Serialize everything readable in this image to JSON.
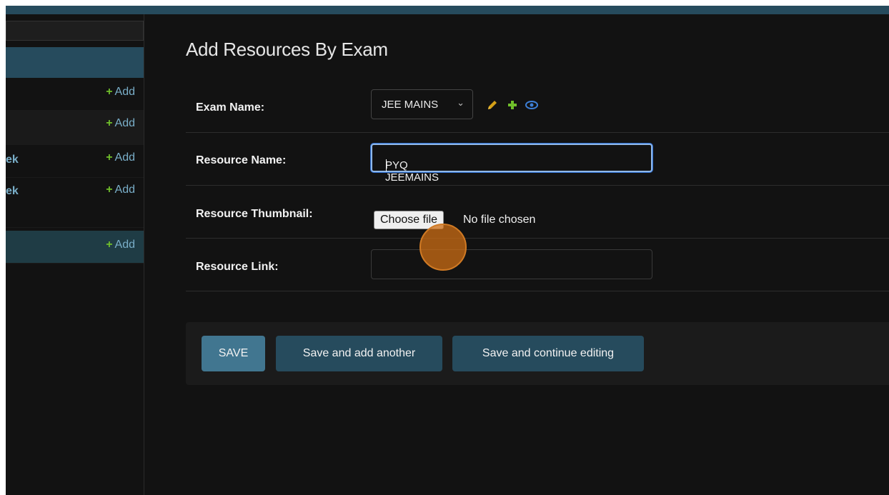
{
  "sidebar": {
    "add_label": "Add",
    "rows": [
      {
        "name": "",
        "style": "plain"
      },
      {
        "name": "",
        "style": "alt"
      },
      {
        "name": "ek",
        "style": "plain"
      },
      {
        "name": "ek",
        "style": "plain"
      },
      {
        "name": "",
        "style": "active"
      }
    ]
  },
  "main": {
    "title": "Add Resources By Exam",
    "exam_name": {
      "label": "Exam Name:",
      "selected": "JEE MAINS"
    },
    "resource_name": {
      "label": "Resource Name:",
      "value": "PYQ JEEMAINS"
    },
    "resource_thumbnail": {
      "label": "Resource Thumbnail:",
      "button": "Choose file",
      "status": "No file chosen"
    },
    "resource_link": {
      "label": "Resource Link:",
      "value": ""
    }
  },
  "actions": {
    "save": "SAVE",
    "save_add_another": "Save and add another",
    "save_continue": "Save and continue editing"
  },
  "colors": {
    "header": "#264b5d",
    "primary_button": "#417690",
    "secondary_button": "#264b5d",
    "link": "#79aec8",
    "add_plus": "#70bf2b",
    "edit_icon": "#d4a017",
    "cursor": "#cd6e14"
  },
  "icons": [
    "pencil-icon",
    "plus-icon",
    "eye-icon",
    "chevron-down-icon"
  ]
}
